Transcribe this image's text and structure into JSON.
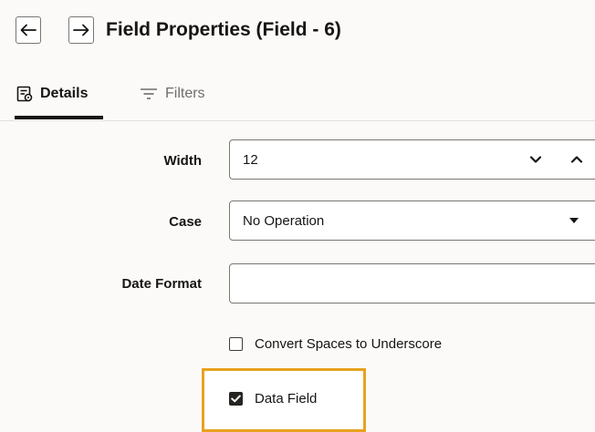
{
  "header": {
    "back_icon": "arrow-left-icon",
    "forward_icon": "arrow-right-icon",
    "title": "Field Properties (Field - 6)"
  },
  "tabs": [
    {
      "label": "Details",
      "icon": "details-icon",
      "selected": true
    },
    {
      "label": "Filters",
      "icon": "filter-icon",
      "selected": false
    }
  ],
  "form": {
    "width": {
      "label": "Width",
      "value": "12"
    },
    "case": {
      "label": "Case",
      "value": "No Operation"
    },
    "date_format": {
      "label": "Date Format",
      "value": ""
    },
    "convert_spaces": {
      "label": "Convert Spaces to Underscore",
      "checked": false
    },
    "data_field": {
      "label": "Data Field",
      "checked": true
    }
  },
  "colors": {
    "highlight": "#e8a21f",
    "background": "#fbfaf8"
  }
}
